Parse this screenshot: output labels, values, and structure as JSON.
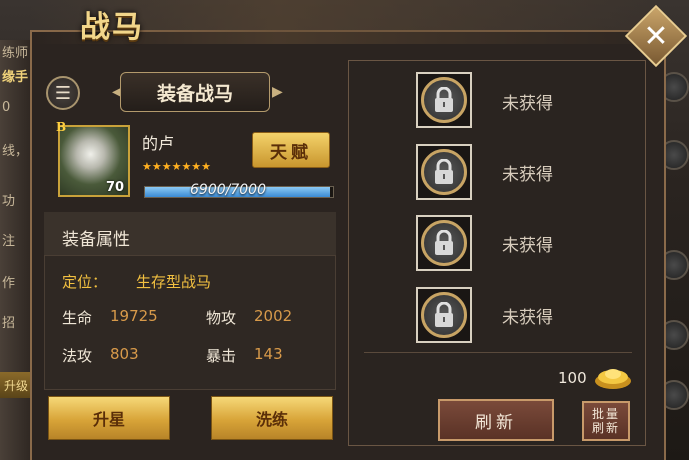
{
  "window": {
    "title": "战马"
  },
  "background": {
    "left_texts": [
      "练师",
      "缘手",
      "0",
      "线，",
      "功",
      "注",
      "作",
      "招"
    ],
    "left_button": "升级"
  },
  "left_panel": {
    "header": "装备战马",
    "horse": {
      "grade": "B",
      "level": "70",
      "name": "的卢",
      "stars": "★★★★★★★",
      "star_count": 7,
      "xp_text": "6900/7000",
      "xp_fraction": 0.9857
    },
    "talent_button": "天赋",
    "attributes": {
      "title": "装备属性",
      "position_label": "定位：",
      "position_value": "生存型战马",
      "stats": [
        {
          "label": "生命",
          "value": "19725"
        },
        {
          "label": "物攻",
          "value": "2002"
        },
        {
          "label": "法攻",
          "value": "803"
        },
        {
          "label": "暴击",
          "value": "143"
        }
      ]
    },
    "buttons": {
      "upgrade_star": "升星",
      "refine": "洗练"
    }
  },
  "right_panel": {
    "slots": [
      {
        "status": "未获得"
      },
      {
        "status": "未获得"
      },
      {
        "status": "未获得"
      },
      {
        "status": "未获得"
      }
    ],
    "gold_amount": "100",
    "refresh_button": "刷新",
    "batch_refresh_line1": "批量",
    "batch_refresh_line2": "刷新"
  },
  "colors": {
    "accent_gold": "#f2d68a",
    "stat_value": "#d89a4a",
    "position_text": "#f2c040",
    "xp_fill": "#3a8ad4"
  }
}
